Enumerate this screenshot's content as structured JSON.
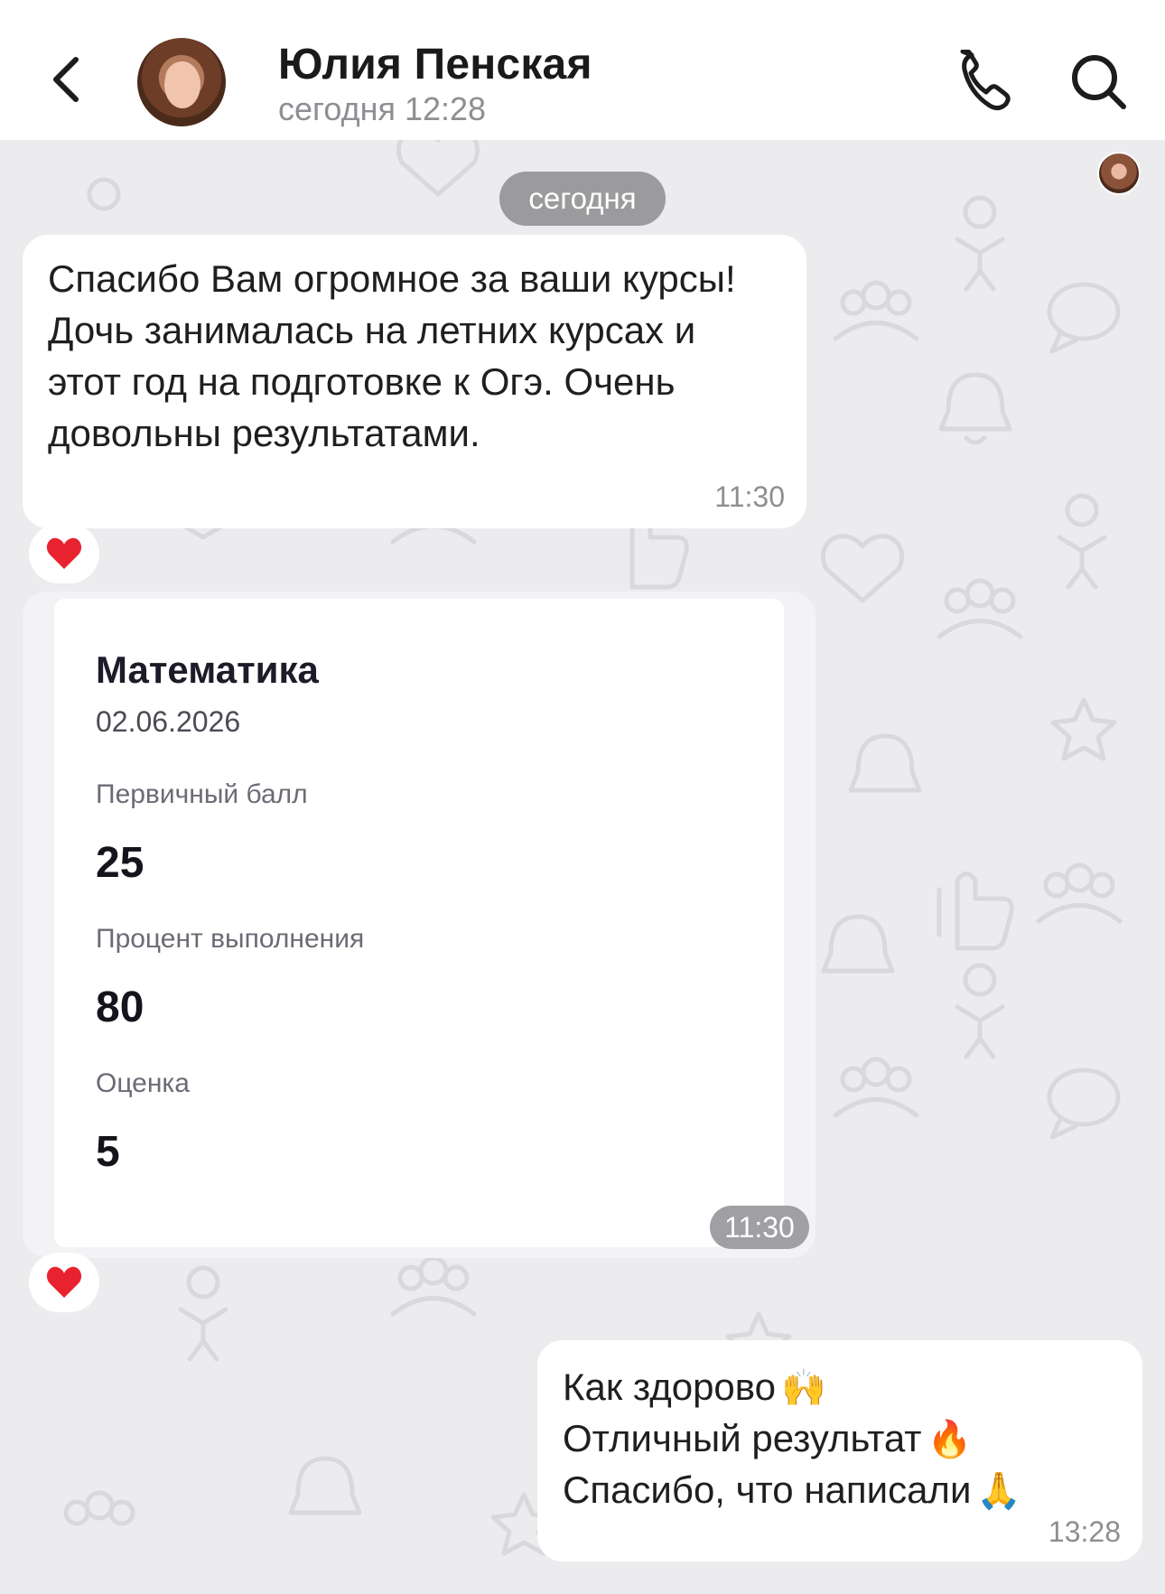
{
  "header": {
    "contact_name": "Юлия Пенская",
    "contact_status": "сегодня 12:28",
    "back_icon": "chevron-left-icon",
    "call_icon": "phone-icon",
    "search_icon": "search-icon"
  },
  "chat": {
    "date_separator": "сегодня",
    "messages": [
      {
        "direction": "incoming",
        "text": "Спасибо Вам огромное за ваши курсы! Дочь занималась на летних курсах и этот год на подготовке к Огэ. Очень довольны результатами.",
        "time": "11:30",
        "reaction": "heart"
      },
      {
        "direction": "incoming",
        "type": "image",
        "time": "11:30",
        "reaction": "heart",
        "card": {
          "subject": "Математика",
          "date": "02.06.2026",
          "primary_score_label": "Первичный балл",
          "primary_score": "25",
          "percent_label": "Процент выполнения",
          "percent": "80",
          "grade_label": "Оценка",
          "grade": "5"
        }
      },
      {
        "direction": "outgoing",
        "lines": [
          {
            "text": "Как здорово",
            "emoji": "🙌"
          },
          {
            "text": "Отличный результат",
            "emoji": "🔥"
          },
          {
            "text": "Спасибо, что написали",
            "emoji": "🙏"
          }
        ],
        "time": "13:28"
      }
    ]
  },
  "colors": {
    "background": "#ececee",
    "bubble": "#ffffff",
    "pill": "#9b9b9e",
    "heart": "#e8232f"
  }
}
